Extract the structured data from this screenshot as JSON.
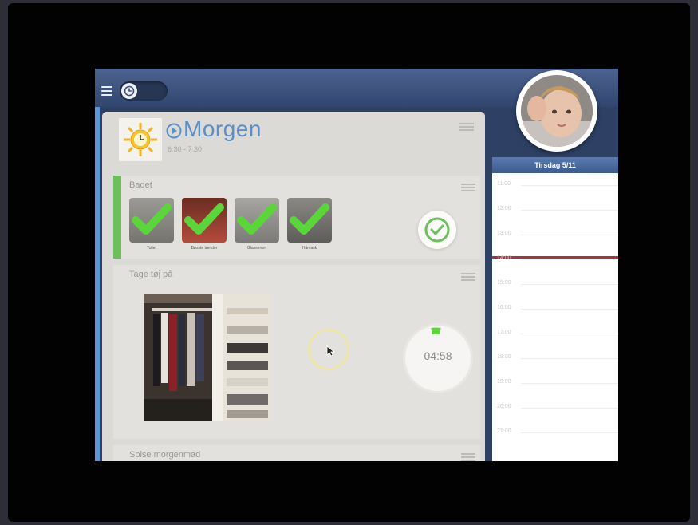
{
  "routine": {
    "title": "Morgen",
    "time": "6:30 - 7:30"
  },
  "tasks": [
    {
      "title": "Badet",
      "status": "completed",
      "subitems": [
        {
          "label": "Toilet"
        },
        {
          "label": "Bøsste tænder"
        },
        {
          "label": "Glasserom"
        },
        {
          "label": "Hårvask"
        }
      ]
    },
    {
      "title": "Tage tøj på",
      "timer": "04:58"
    },
    {
      "title": "Spise morgenmad"
    }
  ],
  "calendar": {
    "day": "Tirsdag 5/11",
    "hours": [
      "11:00",
      "12:00",
      "13:00",
      "14:00",
      "15:00",
      "16:00",
      "17:00",
      "18:00",
      "19:00",
      "20:00",
      "21:00"
    ]
  },
  "colors": {
    "accent": "#5a8fc9",
    "done": "#6cbf5a",
    "now_line": "#a3383c",
    "topbar": "#3f5480"
  },
  "icons": {
    "menu": "menu-icon",
    "timer_toggle": "clock-icon",
    "routine": "sun-clock-icon",
    "play": "play-icon",
    "done": "checkmark-circle-icon"
  }
}
